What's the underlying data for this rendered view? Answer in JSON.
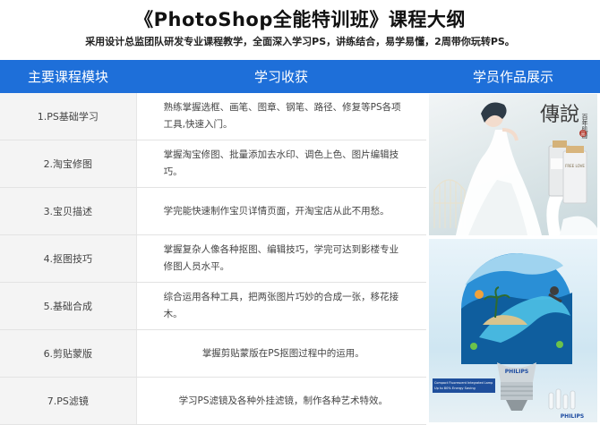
{
  "header": {
    "title": "《PhotoShop全能特训班》课程大纲",
    "subtitle": "采用设计总监团队研发专业课程教学，全面深入学习PS，讲练结合，易学易懂，2周带你玩转PS。"
  },
  "table": {
    "columns": [
      "主要课程模块",
      "学习收获",
      "学员作品展示"
    ],
    "rows": [
      {
        "module": "1.PS基础学习",
        "gain": "熟练掌握选框、画笔、图章、钢笔、路径、修复等PS各项工具,快速入门。"
      },
      {
        "module": "2.淘宝修图",
        "gain": "掌握淘宝修图、批量添加去水印、调色上色、图片编辑技巧。"
      },
      {
        "module": "3.宝贝描述",
        "gain": "学完能快速制作宝贝详情页面，开淘宝店从此不用愁。"
      },
      {
        "module": "4.抠图技巧",
        "gain": "掌握复杂人像各种抠图、编辑技巧，学完可达到影楼专业修图人员水平。"
      },
      {
        "module": "5.基础合成",
        "gain": "综合运用各种工具，把两张图片巧妙的合成一张，移花接木。"
      },
      {
        "module": "6.剪贴蒙版",
        "gain": "掌握剪贴蒙版在PS抠图过程中的运用。"
      },
      {
        "module": "7.PS滤镜",
        "gain": "学习PS滤镜及各种外挂滤镜，制作各种艺术特效。"
      }
    ]
  },
  "showcase": {
    "image1": {
      "calligraphy": "傳說",
      "vertical_text": "百年肌膚",
      "bottle_label": "FREE LOVE",
      "stamp": "品"
    },
    "image2": {
      "brand": "PHILIPS",
      "caption_line1": "Compact Fluorescent Integrated Lamp",
      "caption_line2": "Up to 80% Energy Saving"
    }
  },
  "colors": {
    "header_bar": "#1e6fd9",
    "module_cell": "#f4f4f4"
  }
}
